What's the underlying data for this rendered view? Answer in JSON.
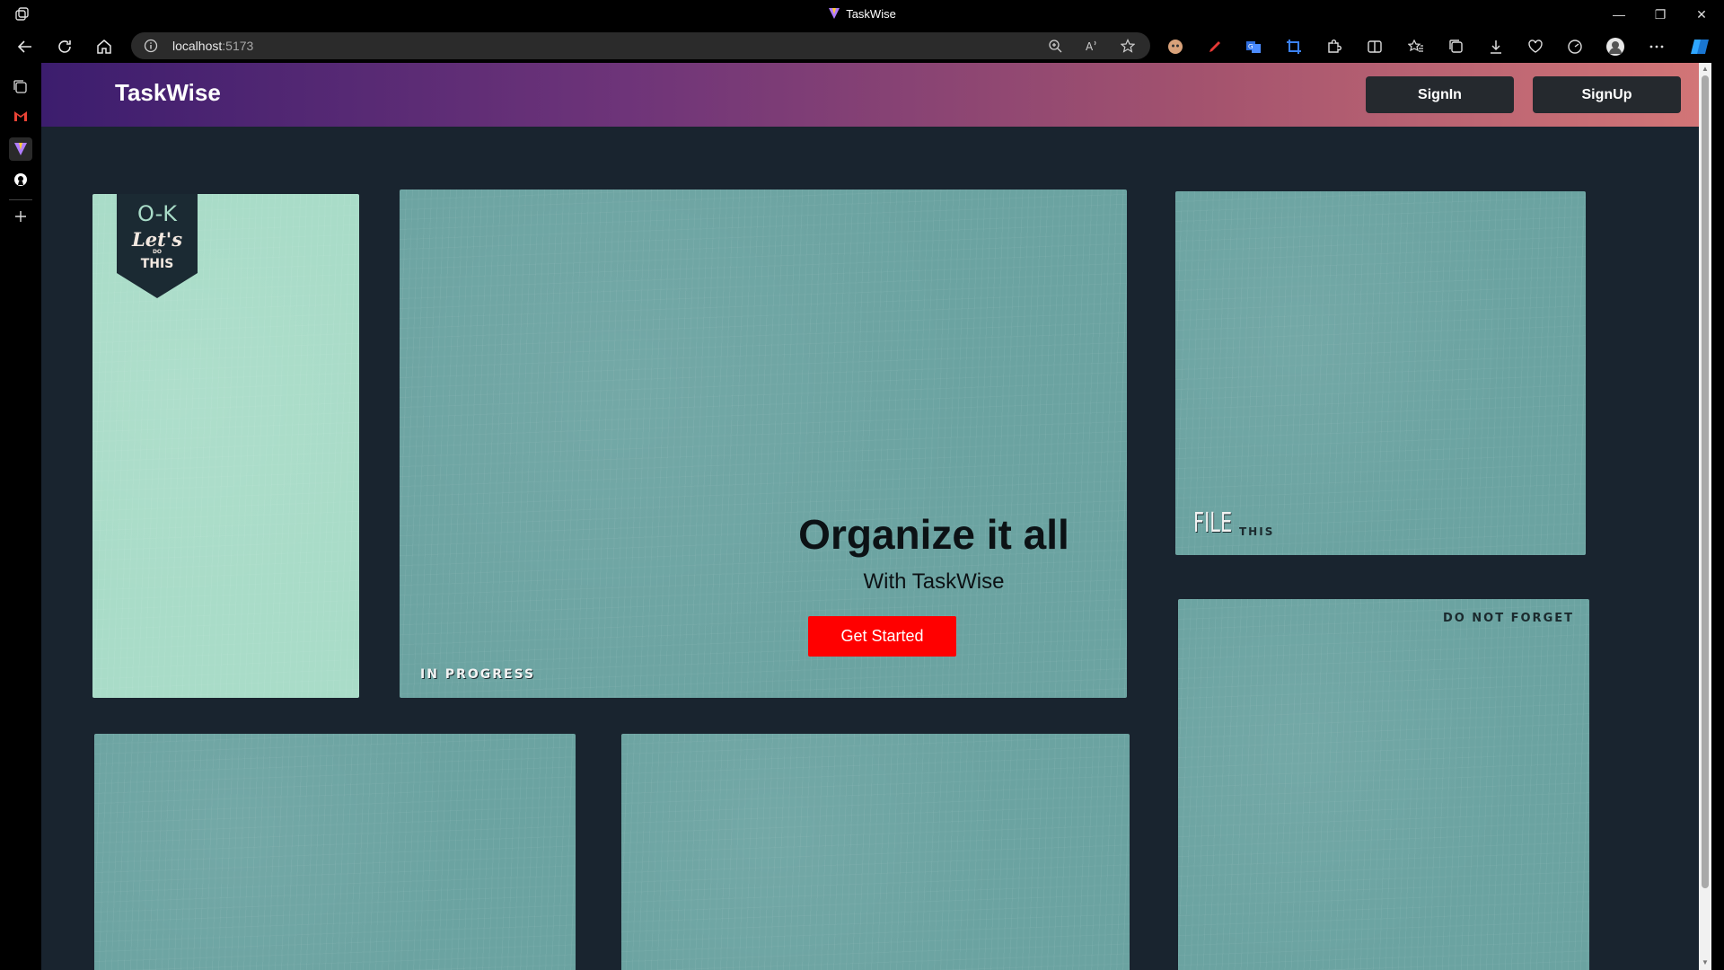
{
  "browser": {
    "window_title": "TaskWise",
    "address": {
      "host": "localhost",
      "port": ":5173"
    }
  },
  "navbar": {
    "brand": "TaskWise",
    "signin_label": "SignIn",
    "signup_label": "SignUp"
  },
  "hero": {
    "title": "Organize it all",
    "subtitle": "With TaskWise",
    "cta_label": "Get Started",
    "tag": "IN PROGRESS"
  },
  "cards": {
    "ribbon": {
      "line1": "O-K",
      "line2": "Let's",
      "line3": "DO",
      "line4": "THIS"
    },
    "file_this": {
      "big": "FILE",
      "small": "THIS"
    },
    "do_not_forget": "DO NOT FORGET"
  },
  "colors": {
    "page_bg": "#19242f",
    "card": "#6ba3a1",
    "card_light": "#a9dcc8",
    "cta": "#ff0000",
    "nav_gradient": [
      "#3c1d6e",
      "#d37677"
    ]
  }
}
